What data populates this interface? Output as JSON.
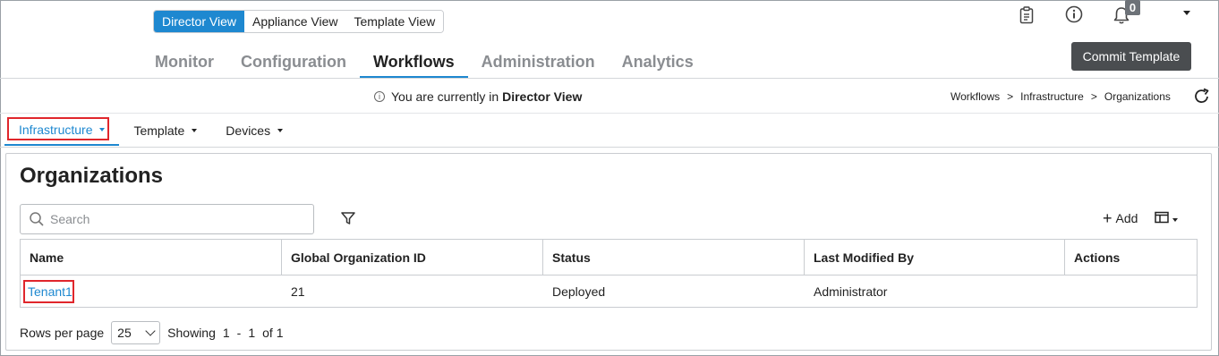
{
  "view_toggle": {
    "director": "Director View",
    "appliance": "Appliance View",
    "template": "Template View"
  },
  "top_icons": {
    "tasks_icon": "clipboard-icon",
    "info_icon": "info-icon",
    "notifications_icon": "bell-icon",
    "notification_count": "0"
  },
  "main_nav": {
    "monitor": "Monitor",
    "configuration": "Configuration",
    "workflows": "Workflows",
    "administration": "Administration",
    "analytics": "Analytics"
  },
  "commit_button": "Commit Template",
  "info_bar": {
    "prefix": "You are currently in",
    "view": "Director View"
  },
  "breadcrumb": {
    "item1": "Workflows",
    "sep": ">",
    "item2": "Infrastructure",
    "item3": "Organizations"
  },
  "sub_tabs": {
    "infrastructure": "Infrastructure",
    "template": "Template",
    "devices": "Devices"
  },
  "page_title": "Organizations",
  "search": {
    "placeholder": "Search",
    "value": ""
  },
  "toolbar": {
    "add_label": "Add"
  },
  "table": {
    "columns": [
      "Name",
      "Global Organization ID",
      "Status",
      "Last Modified By",
      "Actions"
    ],
    "rows": [
      [
        "Tenant1",
        "21",
        "Deployed",
        "Administrator",
        ""
      ]
    ]
  },
  "pagination": {
    "rows_per_page_label": "Rows per page",
    "rows_per_page_value": "25",
    "showing_label": "Showing",
    "from": "1",
    "dash": "-",
    "to": "1",
    "of_label": "of 1"
  },
  "colors": {
    "accent": "#1e88d0",
    "highlight_box": "#e0262c",
    "commit_bg": "#4a4d50"
  }
}
